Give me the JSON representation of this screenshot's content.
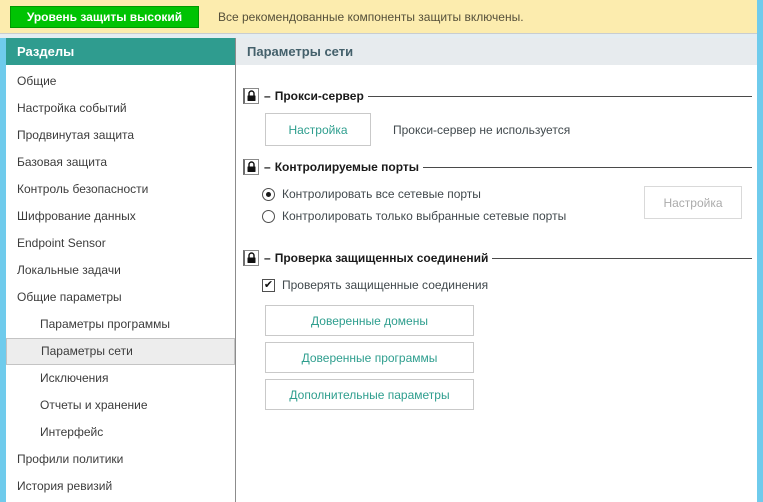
{
  "top_bar": {
    "level_button": "Уровень защиты высокий",
    "message": "Все рекомендованные компоненты защиты включены."
  },
  "sidebar": {
    "title": "Разделы",
    "items": [
      {
        "label": "Общие",
        "indent": 0,
        "selected": false
      },
      {
        "label": "Настройка событий",
        "indent": 0,
        "selected": false
      },
      {
        "label": "Продвинутая защита",
        "indent": 0,
        "selected": false
      },
      {
        "label": "Базовая защита",
        "indent": 0,
        "selected": false
      },
      {
        "label": "Контроль безопасности",
        "indent": 0,
        "selected": false
      },
      {
        "label": "Шифрование данных",
        "indent": 0,
        "selected": false
      },
      {
        "label": "Endpoint Sensor",
        "indent": 0,
        "selected": false
      },
      {
        "label": "Локальные задачи",
        "indent": 0,
        "selected": false
      },
      {
        "label": "Общие параметры",
        "indent": 0,
        "selected": false
      },
      {
        "label": "Параметры программы",
        "indent": 1,
        "selected": false
      },
      {
        "label": "Параметры сети",
        "indent": 1,
        "selected": true
      },
      {
        "label": "Исключения",
        "indent": 1,
        "selected": false
      },
      {
        "label": "Отчеты и хранение",
        "indent": 1,
        "selected": false
      },
      {
        "label": "Интерфейс",
        "indent": 1,
        "selected": false
      },
      {
        "label": "Профили политики",
        "indent": 0,
        "selected": false
      },
      {
        "label": "История ревизий",
        "indent": 0,
        "selected": false
      }
    ]
  },
  "main": {
    "title": "Параметры сети",
    "section_dash": "–",
    "proxy": {
      "title": "Прокси-сервер",
      "configure_button": "Настройка",
      "status": "Прокси-сервер не используется"
    },
    "ports": {
      "title": "Контролируемые порты",
      "radio_all": "Контролировать все сетевые порты",
      "radio_all_checked": true,
      "radio_selected_only": "Контролировать только выбранные сетевые порты",
      "radio_selected_only_checked": false,
      "configure_button": "Настройка",
      "configure_button_enabled": false
    },
    "secure_connections": {
      "title": "Проверка защищенных соединений",
      "checkbox_label": "Проверять защищенные соединения",
      "checkbox_checked": true,
      "trusted_domains_button": "Доверенные домены",
      "trusted_apps_button": "Доверенные программы",
      "additional_params_button": "Дополнительные параметры"
    }
  },
  "icons": {
    "checkmark": "✔"
  },
  "colors": {
    "accent_teal": "#2f9c8f",
    "status_green": "#00c303",
    "banner_yellow": "#fcecae",
    "edge_blue": "#6fcbec",
    "header_grey": "#e7ebee",
    "button_text_teal": "#2e9e8e"
  }
}
